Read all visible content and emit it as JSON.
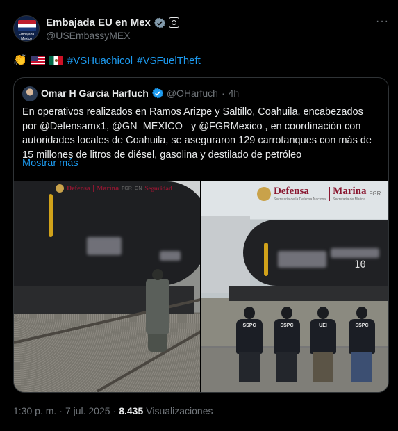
{
  "author": {
    "name": "Embajada EU en Mex",
    "handle": "@USEmbassyMEX",
    "avatar_caption": "Embajada Mexico",
    "verified_badge_icon": "verified-badge-icon",
    "affiliation_icon": "government-badge-icon"
  },
  "more_menu": "···",
  "post": {
    "emoji_clap": "👏",
    "flag_1": "us-flag-icon",
    "flag_2": "mexico-flag-icon",
    "hashtags": [
      "#VSHuachicol",
      "#VSFuelTheft"
    ]
  },
  "quoted": {
    "name": "Omar H Garcia Harfuch",
    "handle": "@OHarfuch",
    "separator": "·",
    "time": "4h",
    "body": "En operativos realizados en Ramos Arizpe y Saltillo, Coahuila, encabezados por @Defensamx1, @GN_MEXICO_  y @FGRMexico , en coordinación con autoridades locales de Coahuila, se aseguraron 129 carrotanques con más de 15 millones de litros de diésel, gasolina y destilado de petróleo",
    "show_more": "Mostrar más",
    "photo_left_banner": {
      "word1": "Defensa",
      "word2": "Marina",
      "word3": "FGR",
      "word4": "GN",
      "word5": "Seguridad"
    },
    "photo_right_banner": {
      "word1": "Defensa",
      "word2": "Marina",
      "sub1": "Secretaría de la Defensa Nacional",
      "sub2": "Secretaría de Marina",
      "word3": "FGR"
    },
    "tank_number": "10",
    "officer_tags": [
      "SSPC",
      "SSPC",
      "UEI",
      "SSPC"
    ]
  },
  "footer": {
    "time": "1:30 p. m.",
    "dot": "·",
    "date": "7 jul. 2025",
    "views_count": "8.435",
    "views_label": "Visualizaciones"
  },
  "colors": {
    "background": "#000000",
    "link": "#1d9bf0",
    "muted": "#71767b",
    "text": "#e7e9ea",
    "border": "#2f3336"
  }
}
